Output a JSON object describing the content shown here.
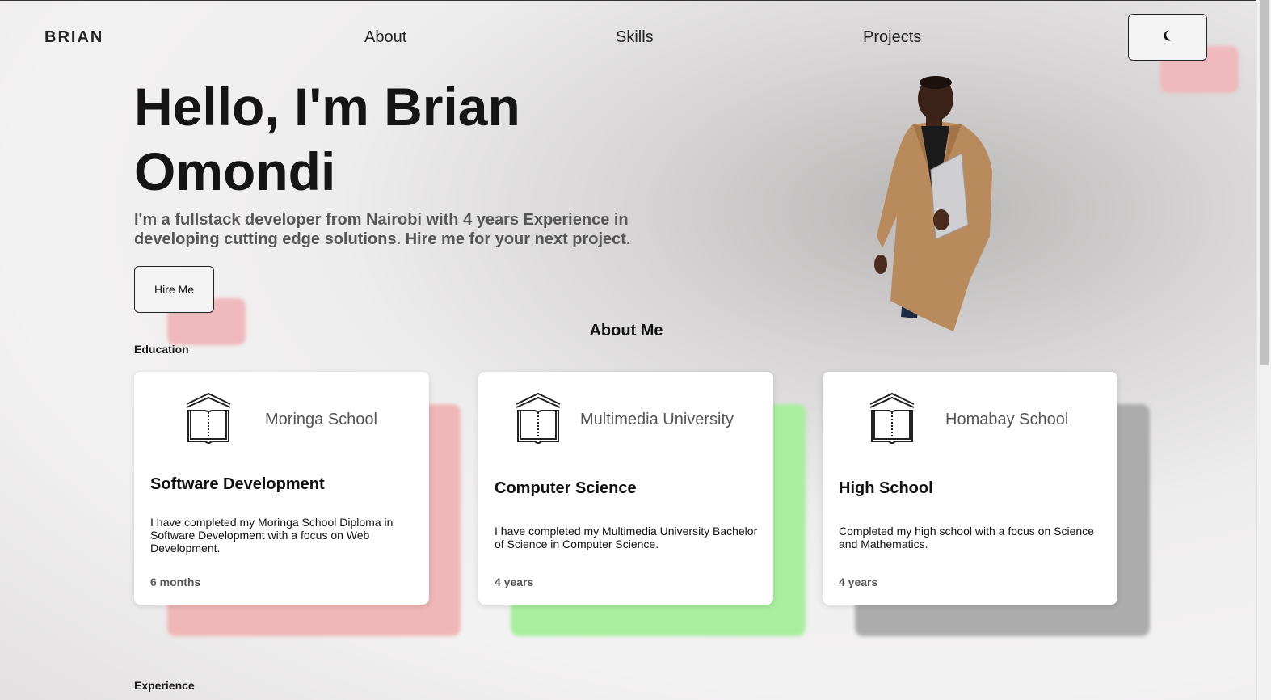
{
  "header": {
    "logo": "BRIAN",
    "nav": [
      {
        "label": "About"
      },
      {
        "label": "Skills"
      },
      {
        "label": "Projects"
      }
    ],
    "theme_toggle_icon": "moon-icon"
  },
  "hero": {
    "title": "Hello, I'm Brian Omondi",
    "subtitle": "I'm a fullstack developer from Nairobi with 4 years Experience in developing cutting edge solutions. Hire me for your next project.",
    "cta_label": "Hire Me"
  },
  "about": {
    "title": "About Me",
    "education_label": "Education",
    "experience_label": "Experience",
    "education": [
      {
        "school": "Moringa School",
        "degree": "Software Development",
        "description": "I have completed my Moringa School Diploma in Software Development with a focus on Web Development.",
        "duration": "6 months",
        "accent": "#ec9a9a"
      },
      {
        "school": "Multimedia University",
        "degree": "Computer Science",
        "description": "I have completed my Multimedia University Bachelor of Science in Computer Science.",
        "duration": "4 years",
        "accent": "#8fe88a"
      },
      {
        "school": "Homabay School",
        "degree": "High School",
        "description": "Completed my high school with a focus on Science and Mathematics.",
        "duration": "4 years",
        "accent": "#9a9a9a"
      }
    ]
  }
}
